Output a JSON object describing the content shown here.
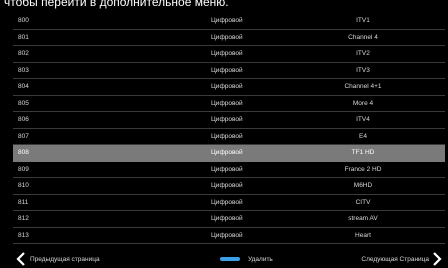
{
  "hint_text": "чтобы перейти в дополнительное меню.",
  "channels": [
    {
      "number": "800",
      "type": "Цифровой",
      "name": "ITV1"
    },
    {
      "number": "801",
      "type": "Цифровой",
      "name": "Channel 4"
    },
    {
      "number": "802",
      "type": "Цифровой",
      "name": "ITV2"
    },
    {
      "number": "803",
      "type": "Цифровой",
      "name": "ITV3"
    },
    {
      "number": "804",
      "type": "Цифровой",
      "name": "Channel 4+1"
    },
    {
      "number": "805",
      "type": "Цифровой",
      "name": "More 4"
    },
    {
      "number": "806",
      "type": "Цифровой",
      "name": "ITV4"
    },
    {
      "number": "807",
      "type": "Цифровой",
      "name": "E4"
    },
    {
      "number": "808",
      "type": "Цифровой",
      "name": "TF1 HD"
    },
    {
      "number": "809",
      "type": "Цифровой",
      "name": "France 2 HD"
    },
    {
      "number": "810",
      "type": "Цифровой",
      "name": "M6HD"
    },
    {
      "number": "811",
      "type": "Цифровой",
      "name": "CITV"
    },
    {
      "number": "812",
      "type": "Цифровой",
      "name": "stream AV"
    },
    {
      "number": "813",
      "type": "Цифровой",
      "name": "Heart"
    }
  ],
  "selected_number": "808",
  "footer": {
    "prev_label": "Предыдущая страница",
    "delete_label": "Удалить",
    "next_label": "Следующая Страница",
    "prev_icon": "chevron-left-icon",
    "next_icon": "chevron-right-icon",
    "delete_key_icon": "blue-key-icon"
  },
  "colors": {
    "background": "#000000",
    "selected_row": "#7a7a7a",
    "text": "#d8d8d8",
    "blue_key": "#3aa0e8"
  }
}
